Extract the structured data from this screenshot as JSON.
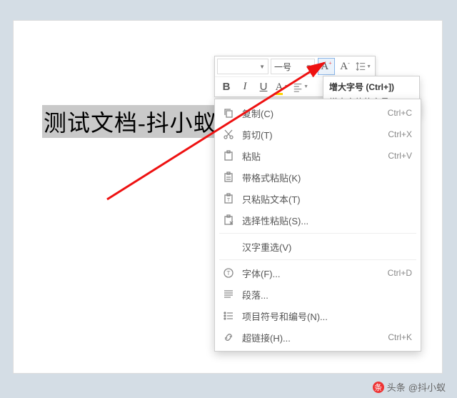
{
  "document": {
    "selected_text": "测试文档-抖小蚁"
  },
  "toolbar": {
    "font_name": "",
    "font_size": "一号",
    "grow_font": "A",
    "shrink_font": "A",
    "bold": "B",
    "italic": "I",
    "underline": "U",
    "highlight": "A"
  },
  "tooltip": {
    "title": "增大字号 (Ctrl+])",
    "desc": "增大字体的字号。"
  },
  "menu": {
    "items": [
      {
        "icon": "copy",
        "label": "复制(C)",
        "shortcut": "Ctrl+C"
      },
      {
        "icon": "cut",
        "label": "剪切(T)",
        "shortcut": "Ctrl+X"
      },
      {
        "icon": "paste",
        "label": "粘贴",
        "shortcut": "Ctrl+V"
      },
      {
        "icon": "pastefmt",
        "label": "带格式粘贴(K)",
        "shortcut": ""
      },
      {
        "icon": "pastetxt",
        "label": "只粘贴文本(T)",
        "shortcut": ""
      },
      {
        "icon": "pastesel",
        "label": "选择性粘贴(S)...",
        "shortcut": ""
      },
      {
        "sep": true
      },
      {
        "icon": "",
        "label": "汉字重选(V)",
        "shortcut": ""
      },
      {
        "sep": true
      },
      {
        "icon": "typeface",
        "label": "字体(F)...",
        "shortcut": "Ctrl+D"
      },
      {
        "icon": "paragraph",
        "label": "段落...",
        "shortcut": ""
      },
      {
        "icon": "bullets",
        "label": "项目符号和编号(N)...",
        "shortcut": ""
      },
      {
        "icon": "link",
        "label": "超链接(H)...",
        "shortcut": "Ctrl+K"
      }
    ]
  },
  "watermark": {
    "prefix": "头条",
    "handle": "@抖小蚁"
  }
}
